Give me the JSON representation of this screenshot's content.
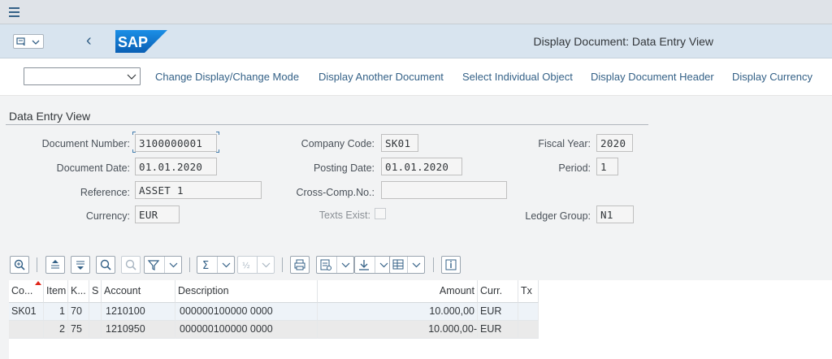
{
  "header": {
    "title": "Display Document: Data Entry View",
    "logo_text": "SAP"
  },
  "toolbar": {
    "select_value": "",
    "buttons": [
      "Change Display/Change Mode",
      "Display Another Document",
      "Select Individual Object",
      "Display Document Header",
      "Display Currency"
    ]
  },
  "form": {
    "section_title": "Data Entry View",
    "document_number_label": "Document Number:",
    "document_number": "3100000001",
    "company_code_label": "Company Code:",
    "company_code": "SK01",
    "fiscal_year_label": "Fiscal Year:",
    "fiscal_year": "2020",
    "document_date_label": "Document Date:",
    "document_date": "01.01.2020",
    "posting_date_label": "Posting Date:",
    "posting_date": "01.01.2020",
    "period_label": "Period:",
    "period": "1",
    "reference_label": "Reference:",
    "reference": "ASSET 1",
    "cross_comp_label": "Cross-Comp.No.:",
    "cross_comp": "",
    "currency_label": "Currency:",
    "currency": "EUR",
    "texts_exist_label": "Texts Exist:",
    "texts_exist": false,
    "ledger_group_label": "Ledger Group:",
    "ledger_group": "N1"
  },
  "table": {
    "columns": [
      "Co...",
      "Item",
      "K...",
      "S",
      "Account",
      "Description",
      "Amount",
      "Curr.",
      "Tx"
    ],
    "rows": [
      {
        "co": "SK01",
        "item": "1",
        "k": "70",
        "s": "",
        "account": "1210100",
        "description": "000000100000 0000",
        "amount": "10.000,00",
        "curr": "EUR",
        "tx": ""
      },
      {
        "co": "",
        "item": "2",
        "k": "75",
        "s": "",
        "account": "1210950",
        "description": "000000100000 0000",
        "amount": "10.000,00-",
        "curr": "EUR",
        "tx": ""
      }
    ]
  },
  "colors": {
    "header_bg": "#d8e4ef",
    "link": "#346187",
    "sap_blue": "#0a6ed1"
  }
}
